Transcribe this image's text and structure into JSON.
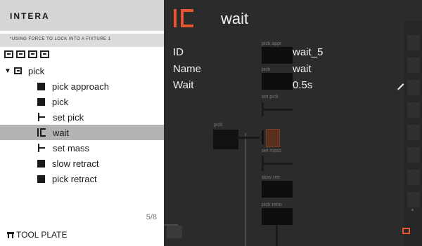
{
  "app": {
    "brand": "INTERA",
    "hint": "*USING FORCE TO LOCK INTO A FIXTURE 1"
  },
  "toolbar": {
    "buttons": [
      "box-icon",
      "box-icon",
      "box-icon",
      "box-icon"
    ]
  },
  "tree": {
    "parent_label": "pick",
    "items": [
      {
        "label": "pick approach",
        "icon": "square-icon"
      },
      {
        "label": "pick",
        "icon": "square-icon"
      },
      {
        "label": "set pick",
        "icon": "bracket-icon"
      },
      {
        "label": "wait",
        "icon": "wait-icon",
        "selected": true
      },
      {
        "label": "set mass",
        "icon": "bracket-icon"
      },
      {
        "label": "slow retract",
        "icon": "square-icon"
      },
      {
        "label": "pick retract",
        "icon": "square-icon"
      }
    ]
  },
  "pagination": "5/8",
  "tool_plate": "TOOL PLATE",
  "detail": {
    "title": "wait",
    "fields": [
      {
        "label": "ID",
        "value": "wait_5"
      },
      {
        "label": "Name",
        "value": "wait"
      },
      {
        "label": "Wait",
        "value": "0.5s"
      }
    ]
  },
  "graph": {
    "group_label": "pick",
    "nodes": [
      "pick appr",
      "pick",
      "set pick",
      "set mass",
      "slow retr",
      "pick retro"
    ]
  },
  "colors": {
    "accent": "#e8552f",
    "selected_row": "#b4b4b4",
    "right_bg": "#2b2b2b"
  }
}
